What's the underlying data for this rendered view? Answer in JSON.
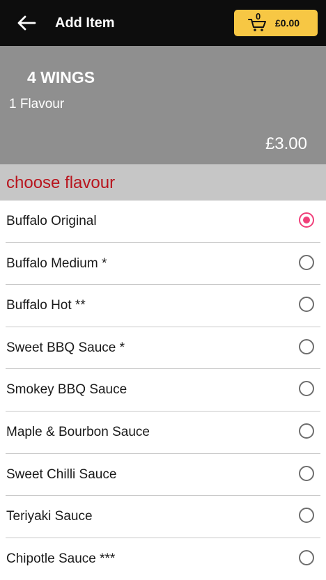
{
  "header": {
    "title": "Add Item",
    "cart_count": "0",
    "cart_total": "£0.00",
    "accent_color": "#f7c744"
  },
  "item": {
    "name": "4 WINGS",
    "description": "1 Flavour",
    "price": "£3.00"
  },
  "section": {
    "title": "choose flavour",
    "title_color": "#b8141d"
  },
  "options": [
    {
      "label": "Buffalo Original",
      "selected": true
    },
    {
      "label": "Buffalo Medium *",
      "selected": false
    },
    {
      "label": "Buffalo Hot **",
      "selected": false
    },
    {
      "label": "Sweet BBQ Sauce *",
      "selected": false
    },
    {
      "label": "Smokey BBQ Sauce",
      "selected": false
    },
    {
      "label": "Maple & Bourbon Sauce",
      "selected": false
    },
    {
      "label": "Sweet Chilli Sauce",
      "selected": false
    },
    {
      "label": "Teriyaki Sauce",
      "selected": false
    },
    {
      "label": "Chipotle Sauce ***",
      "selected": false
    }
  ],
  "icons": {
    "back": "arrow-left-icon",
    "cart": "shopping-cart-icon"
  }
}
